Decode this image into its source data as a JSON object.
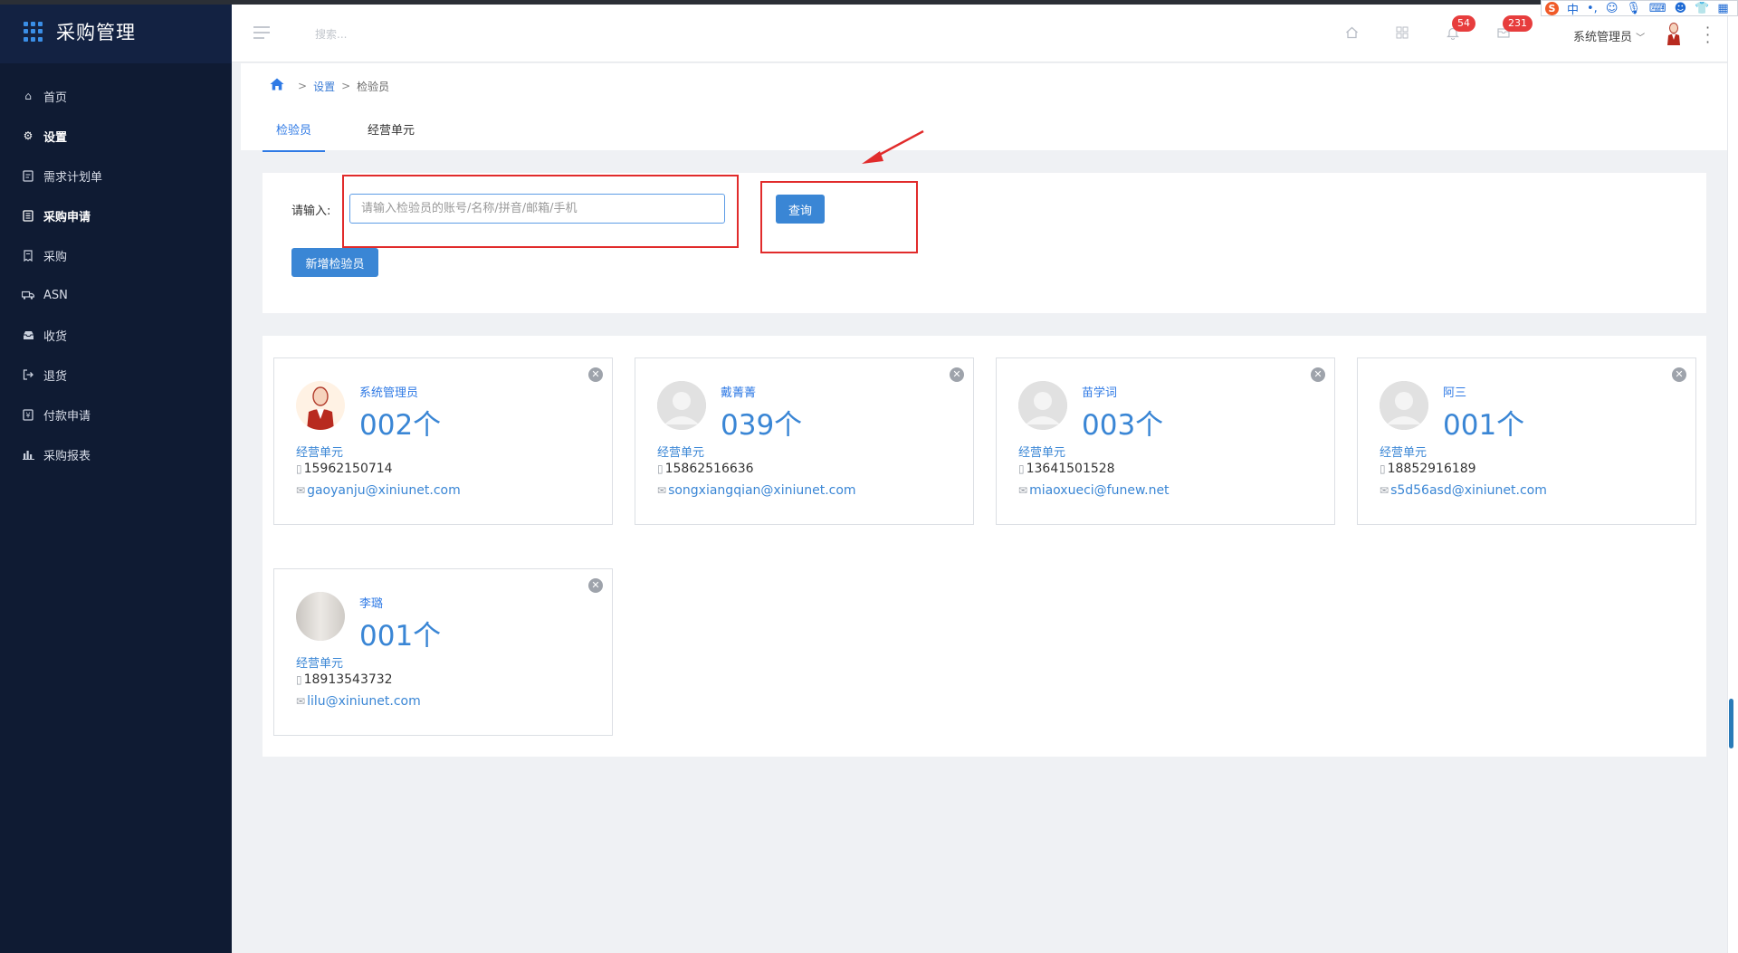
{
  "app": {
    "title": "采购管理"
  },
  "sidebar": {
    "items": [
      {
        "label": "首页",
        "icon": "home-icon"
      },
      {
        "label": "设置",
        "icon": "gear-icon"
      },
      {
        "label": "需求计划单",
        "icon": "document-icon"
      },
      {
        "label": "采购申请",
        "icon": "clipboard-icon"
      },
      {
        "label": "采购",
        "icon": "receipt-icon"
      },
      {
        "label": "ASN",
        "icon": "truck-icon"
      },
      {
        "label": "收货",
        "icon": "inbox-icon"
      },
      {
        "label": "退货",
        "icon": "return-icon"
      },
      {
        "label": "付款申请",
        "icon": "payment-icon"
      },
      {
        "label": "采购报表",
        "icon": "bar-chart-icon"
      }
    ]
  },
  "header": {
    "search_placeholder": "搜索...",
    "notifications_count": "54",
    "messages_count": "231",
    "user_name": "系统管理员"
  },
  "breadcrumb": {
    "level1": "设置",
    "level2": "检验员"
  },
  "tabs": [
    {
      "label": "检验员"
    },
    {
      "label": "经营单元"
    }
  ],
  "filter": {
    "label": "请输入:",
    "placeholder": "请输入检验员的账号/名称/拼音/邮箱/手机",
    "query_button": "查询",
    "add_button": "新增检验员"
  },
  "cards": [
    {
      "name": "系统管理员",
      "count": "002个",
      "unit": "经营单元",
      "phone": "15962150714",
      "email": "gaoyanju@xiniunet.com"
    },
    {
      "name": "戴菁菁",
      "count": "039个",
      "unit": "经营单元",
      "phone": "15862516636",
      "email": "songxiangqian@xiniunet.com"
    },
    {
      "name": "苗学词",
      "count": "003个",
      "unit": "经营单元",
      "phone": "13641501528",
      "email": "miaoxueci@funew.net"
    },
    {
      "name": "阿三",
      "count": "001个",
      "unit": "经营单元",
      "phone": "18852916189",
      "email": "s5d56asd@xiniunet.com"
    },
    {
      "name": "李璐",
      "count": "001个",
      "unit": "经营单元",
      "phone": "18913543732",
      "email": "lilu@xiniunet.com"
    }
  ],
  "colors": {
    "sidebar_bg": "#0f1b33",
    "accent": "#3a86d5",
    "badge": "#e73d3d",
    "annotation": "#e12b2b"
  }
}
